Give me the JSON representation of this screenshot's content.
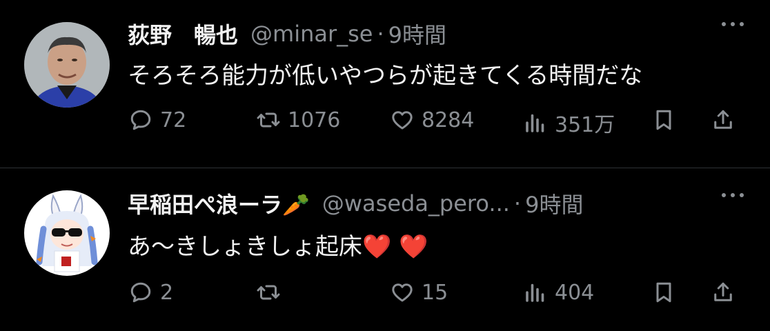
{
  "tweets": [
    {
      "name": "荻野　暢也",
      "handle": "@minar_se",
      "separator": "·",
      "time": "9時間",
      "text": "そろそろ能力が低いやつらが起きてくる時間だな",
      "replies": "72",
      "retweets": "1076",
      "likes": "8284",
      "views": "351万"
    },
    {
      "name": "早稲田ぺ浪ーラ🥕",
      "handle": "@waseda_pero...",
      "separator": "·",
      "time": "9時間",
      "text": "あ〜きしょきしょ起床❤️ ❤️",
      "replies": "2",
      "retweets": "",
      "likes": "15",
      "views": "404"
    }
  ],
  "icons": [
    "reply-icon",
    "retweet-icon",
    "like-icon",
    "views-icon",
    "bookmark-icon",
    "share-icon",
    "more-icon"
  ],
  "colors": {
    "background": "#000000",
    "text": "#e7e9ea",
    "muted": "#8b8f94",
    "divider": "#2f3336"
  }
}
